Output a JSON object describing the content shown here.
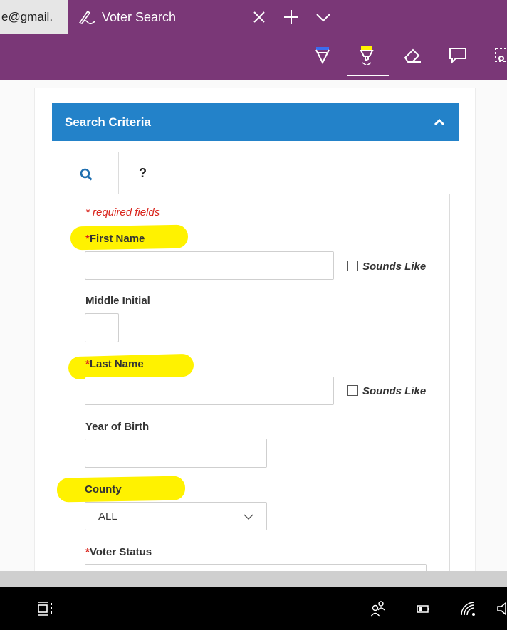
{
  "browser": {
    "prev_tab_title": "e@gmail.",
    "active_tab_title": "Voter Search",
    "icons": [
      "pen-icon",
      "close-icon",
      "plus-icon",
      "chevron-down-icon"
    ]
  },
  "ink_toolbar": {
    "tools": [
      "ballpoint-pen-icon",
      "highlighter-icon",
      "eraser-icon",
      "comment-icon",
      "clip-icon"
    ],
    "active_tool": "highlighter-icon",
    "colors": {
      "toolbar": "#7a3777",
      "pen": "#3a6df0",
      "highlighter": "#fff200"
    }
  },
  "panel": {
    "title": "Search Criteria",
    "header_color": "#2382c9",
    "tabs": {
      "search_icon": "search-icon",
      "help_label": "?"
    }
  },
  "form": {
    "required_note": "* required fields",
    "required_marker": "*",
    "first_name": {
      "label": "First Name",
      "value": ""
    },
    "first_sounds_like": {
      "label": "Sounds Like",
      "checked": false
    },
    "middle_initial": {
      "label": "Middle Initial",
      "value": ""
    },
    "last_name": {
      "label": "Last Name",
      "value": ""
    },
    "last_sounds_like": {
      "label": "Sounds Like",
      "checked": false
    },
    "year_of_birth": {
      "label": "Year of Birth",
      "value": ""
    },
    "county": {
      "label": "County",
      "selected": "ALL"
    },
    "voter_status": {
      "label": "Voter Status"
    }
  },
  "taskbar": {
    "icons": [
      "task-view-icon",
      "people-icon",
      "battery-icon",
      "wifi-icon",
      "volume-icon"
    ]
  }
}
